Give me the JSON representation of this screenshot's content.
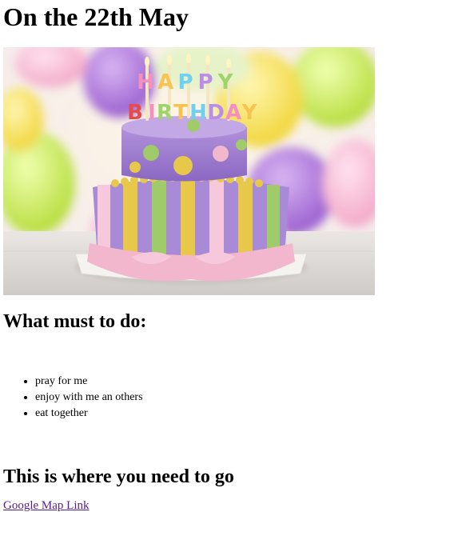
{
  "heading": "On the 22th May",
  "hero_image": {
    "alt": "Happy Birthday cake",
    "cake_lettering_top": "HAPPY",
    "cake_lettering_bottom": "BIRTHDAY"
  },
  "todo": {
    "title": "What must to do:",
    "items": [
      "pray for me",
      "enjoy with me an others",
      "eat together"
    ]
  },
  "location": {
    "title": "This is where you need to go",
    "link_text": "Google Map Link"
  },
  "colors": {
    "link_visited": "#551A8B",
    "cake_purple": "#9B7FC9",
    "cake_yellow": "#E8C84A",
    "cake_pink": "#F2B7CC",
    "cake_green": "#9FCB6A"
  }
}
